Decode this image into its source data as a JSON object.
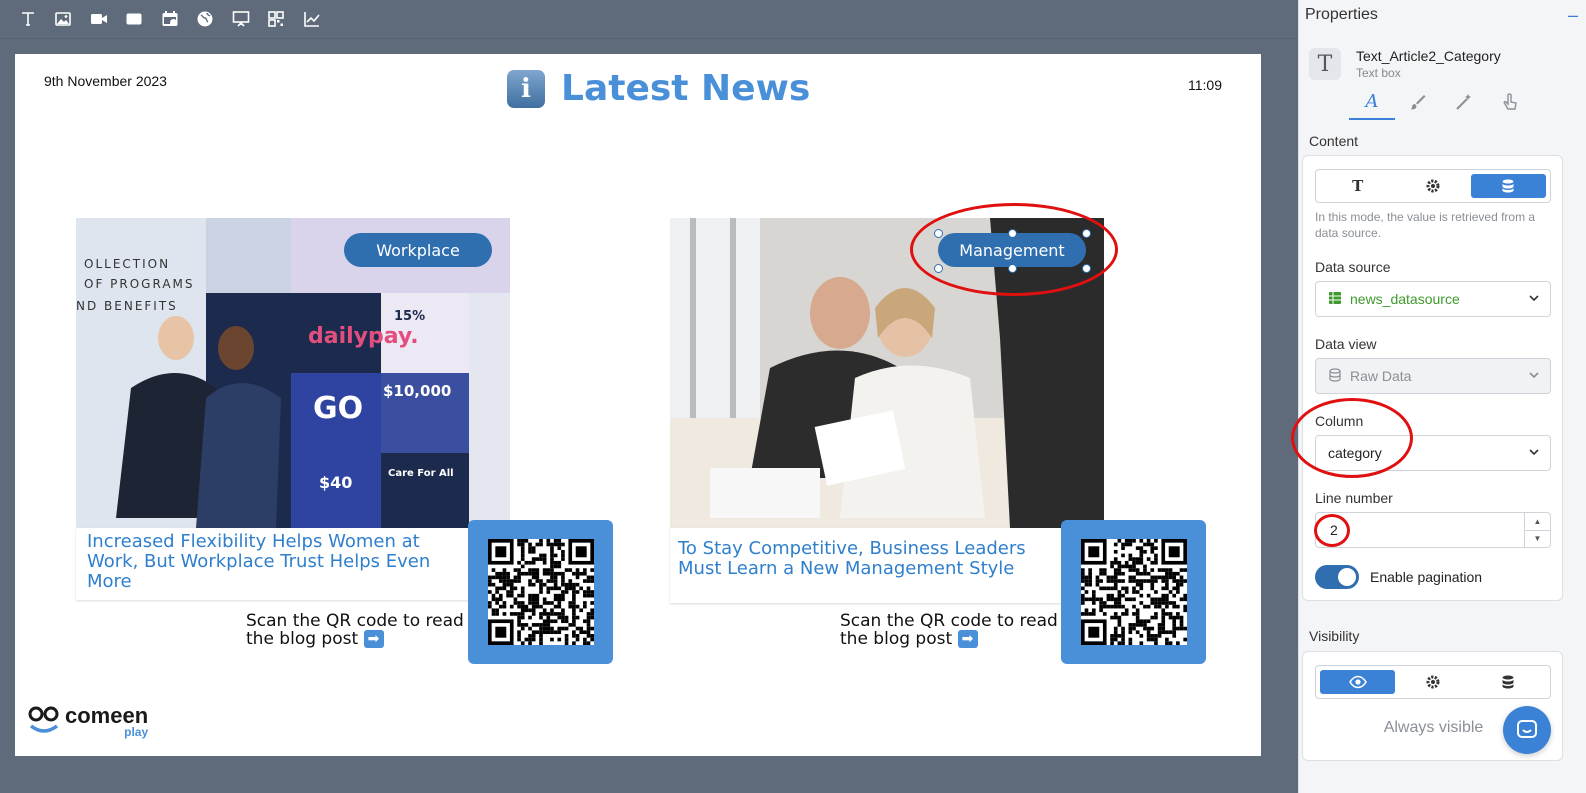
{
  "toolbar": {
    "tools": [
      {
        "icon": "text-tool-icon"
      },
      {
        "icon": "image-tool-icon"
      },
      {
        "icon": "video-tool-icon"
      },
      {
        "icon": "shape-tool-icon"
      },
      {
        "icon": "calendar-tool-icon"
      },
      {
        "icon": "web-tool-icon"
      },
      {
        "icon": "presentation-tool-icon"
      },
      {
        "icon": "qr-tool-icon"
      },
      {
        "icon": "chart-tool-icon"
      }
    ]
  },
  "slide": {
    "date": "9th November 2023",
    "time": "11:09",
    "title": "Latest News",
    "articles": [
      {
        "category": "Workplace",
        "headline": "Increased Flexibility Helps Women at Work, But Workplace Trust Helps Even More",
        "scan_text": "Scan the QR code to read the blog post"
      },
      {
        "category": "Management",
        "headline": "To Stay Competitive, Business Leaders Must Learn a New Management Style",
        "scan_text": "Scan the QR code to read the blog post"
      }
    ],
    "logo": {
      "name": "comeen",
      "sub": "play"
    }
  },
  "panel": {
    "title": "Properties",
    "element_name": "Text_Article2_Category",
    "element_type": "Text box",
    "content_label": "Content",
    "mode_hint": "In this mode, the value is retrieved from a data source.",
    "data_source_label": "Data source",
    "data_source_value": "news_datasource",
    "data_view_label": "Data view",
    "data_view_value": "Raw Data",
    "column_label": "Column",
    "column_value": "category",
    "line_number_label": "Line number",
    "line_number_value": "2",
    "pagination_label": "Enable pagination",
    "pagination_enabled": true,
    "visibility_label": "Visibility",
    "visibility_value": "Always visible"
  },
  "colors": {
    "accent": "#3b82d6",
    "pill": "#2f6fb0",
    "headline": "#2f7fcd",
    "annotation": "#e01010",
    "datasource_green": "#3f9a2d"
  }
}
